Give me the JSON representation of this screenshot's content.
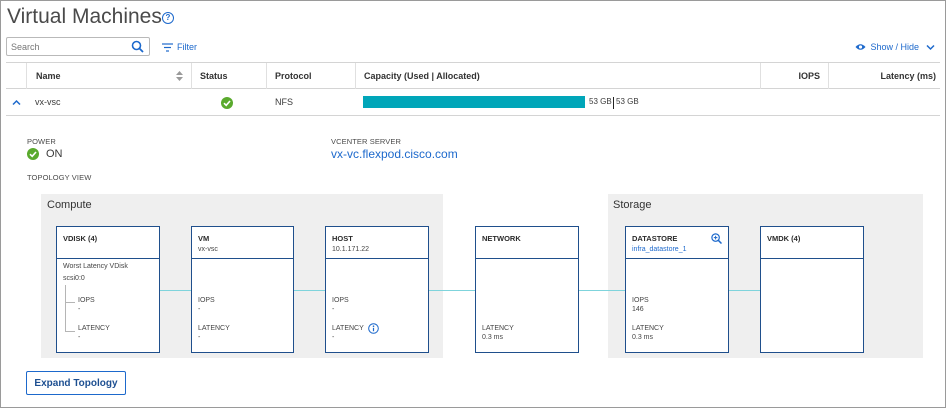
{
  "header": {
    "title": "Virtual Machines",
    "help_icon": "question-circle-icon"
  },
  "toolbar": {
    "search_placeholder": "Search",
    "filter_label": "Filter",
    "show_hide_label": "Show / Hide"
  },
  "table": {
    "columns": [
      "Name",
      "Status",
      "Protocol",
      "Capacity (Used | Allocated)",
      "IOPS",
      "Latency (ms)"
    ],
    "rows": [
      {
        "name": "vx-vsc",
        "status": "ok",
        "protocol": "NFS",
        "capacity_used": "53 GB",
        "capacity_allocated": "53 GB",
        "capacity_fraction": 1.0,
        "iops": "",
        "latency": ""
      }
    ]
  },
  "details": {
    "power_label": "POWER",
    "power_value": "ON",
    "vcenter_label": "VCENTER SERVER",
    "vcenter_value": "vx-vc.flexpod.cisco.com",
    "topology_label": "TOPOLOGY VIEW"
  },
  "topology": {
    "compute_title": "Compute",
    "storage_title": "Storage",
    "nodes": {
      "vdisk": {
        "title": "VDISK (4)",
        "worst_label": "Worst Latency VDisk",
        "disk": "scsi0:0",
        "iops_label": "IOPS",
        "iops_value": "-",
        "latency_label": "LATENCY",
        "latency_value": "-"
      },
      "vm": {
        "title": "VM",
        "sub": "vx-vsc",
        "iops_label": "IOPS",
        "iops_value": "-",
        "latency_label": "LATENCY",
        "latency_value": "-"
      },
      "host": {
        "title": "HOST",
        "sub": "10.1.171.22",
        "iops_label": "IOPS",
        "iops_value": "-",
        "latency_label": "LATENCY",
        "latency_value": "-"
      },
      "network": {
        "title": "NETWORK",
        "latency_label": "LATENCY",
        "latency_value": "0.3 ms"
      },
      "datastore": {
        "title": "DATASTORE",
        "sub": "infra_datastore_1",
        "iops_label": "IOPS",
        "iops_value": "146",
        "latency_label": "LATENCY",
        "latency_value": "0.3 ms"
      },
      "vmdk": {
        "title": "VMDK (4)"
      }
    }
  },
  "expand_button_label": "Expand Topology",
  "colors": {
    "accent": "#1d69cc",
    "capacity_bar": "#00a6b9",
    "ok_green": "#5aaa2d",
    "node_border": "#1f4f8c",
    "connector": "#7fd4dc"
  }
}
